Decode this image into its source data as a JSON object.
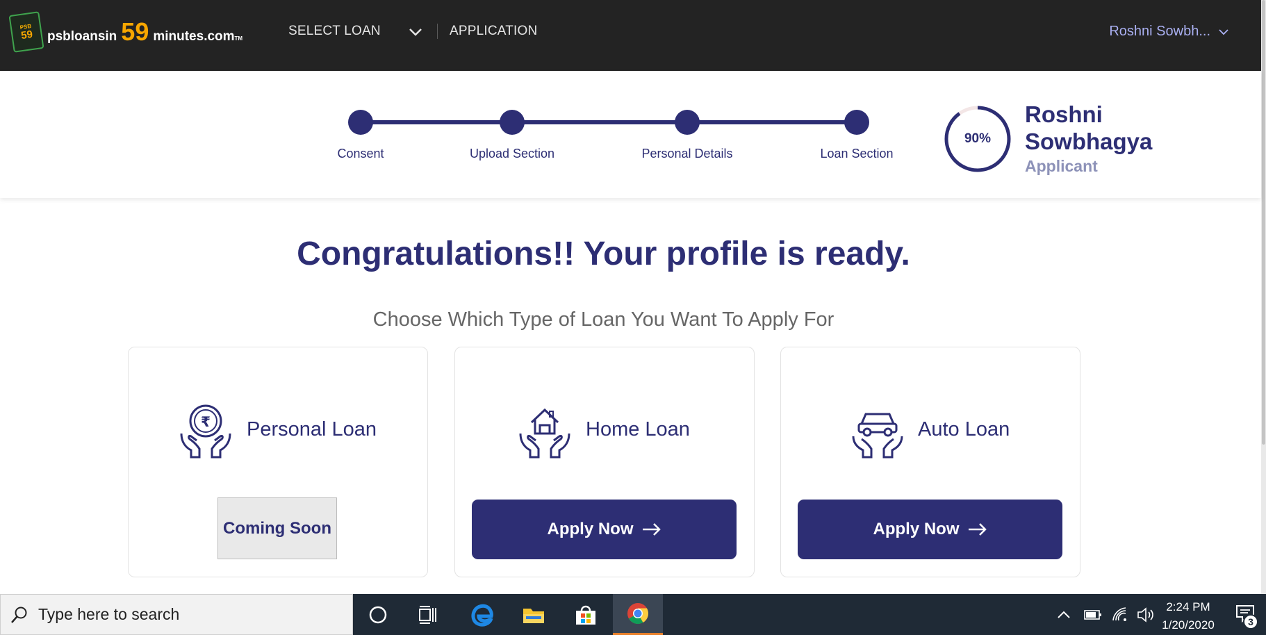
{
  "navbar": {
    "logo": {
      "psb": "PSB",
      "num_small": "59",
      "brand_prefix": "psbloansin",
      "brand_number": "59",
      "brand_suffix": "minutes.com",
      "tm": "TM"
    },
    "select_loan_label": "SELECT LOAN",
    "application_label": "APPLICATION",
    "user_name": "Roshni Sowbh..."
  },
  "progress": {
    "steps": [
      {
        "label": "Consent"
      },
      {
        "label": "Upload Section"
      },
      {
        "label": "Personal Details"
      },
      {
        "label": "Loan Section"
      }
    ],
    "completion_percent": 90,
    "completion_label": "90%",
    "profile_name": "Roshni Sowbhagya",
    "profile_role": "Applicant"
  },
  "main": {
    "headline": "Congratulations!! Your profile is ready.",
    "subhead": "Choose Which Type of Loan You Want To Apply For",
    "cards": [
      {
        "title": "Personal Loan",
        "button": "Coming Soon",
        "button_state": "disabled",
        "icon": "rupee-coin-hands-icon"
      },
      {
        "title": "Home Loan",
        "button": "Apply Now",
        "button_state": "enabled",
        "icon": "house-hands-icon"
      },
      {
        "title": "Auto Loan",
        "button": "Apply Now",
        "button_state": "enabled",
        "icon": "car-hands-icon"
      }
    ]
  },
  "taskbar": {
    "search_placeholder": "Type here to search",
    "apps": [
      "cortana-icon",
      "task-view-icon",
      "edge-icon",
      "file-explorer-icon",
      "store-icon",
      "chrome-icon"
    ],
    "time": "2:24 PM",
    "date": "1/20/2020",
    "notification_count": "3"
  },
  "colors": {
    "brand": "#2d2e74",
    "navbar_bg": "#232323",
    "accent_orange": "#f7a600",
    "user_link": "#a9aff0"
  }
}
